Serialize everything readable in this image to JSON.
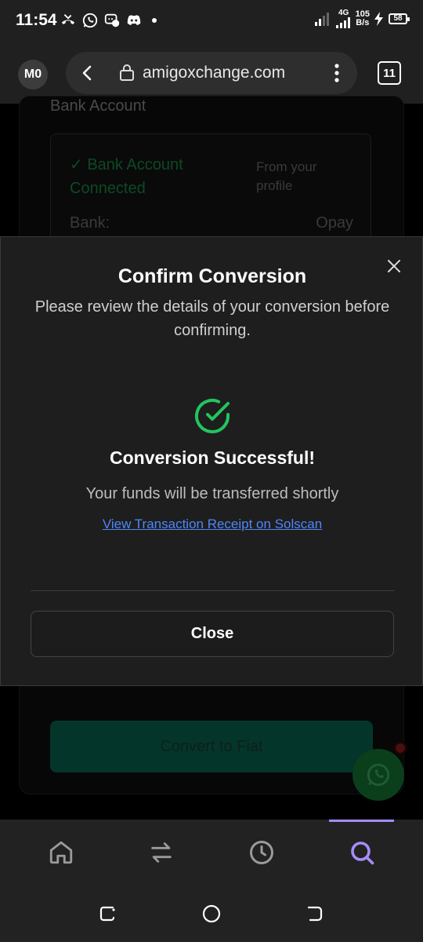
{
  "status_bar": {
    "time": "11:54",
    "network_label": "4G",
    "speed_value": "105",
    "speed_unit": "B/s",
    "battery": "58"
  },
  "browser": {
    "profile_initials": "M0",
    "url": "amigoxchange.com",
    "tab_count": "11"
  },
  "background_page": {
    "section_title": "Bank Account",
    "bank_status": "✓ Bank Account Connected",
    "bank_source": "From your profile",
    "bank_label": "Bank:",
    "bank_value": "Opay",
    "convert_button": "Convert to Fiat"
  },
  "modal": {
    "title": "Confirm Conversion",
    "subtitle": "Please review the details of your conversion before confirming.",
    "success_title": "Conversion Successful!",
    "success_message": "Your funds will be transferred shortly",
    "receipt_link": "View Transaction Receipt on Solscan",
    "close_button": "Close"
  },
  "colors": {
    "success_green": "#22c55e",
    "link_blue": "#4f86f7",
    "nav_active": "#a78bfa"
  },
  "bottom_nav": {
    "items": [
      "home-icon",
      "swap-icon",
      "history-icon",
      "search-icon"
    ],
    "active": "search-icon"
  }
}
